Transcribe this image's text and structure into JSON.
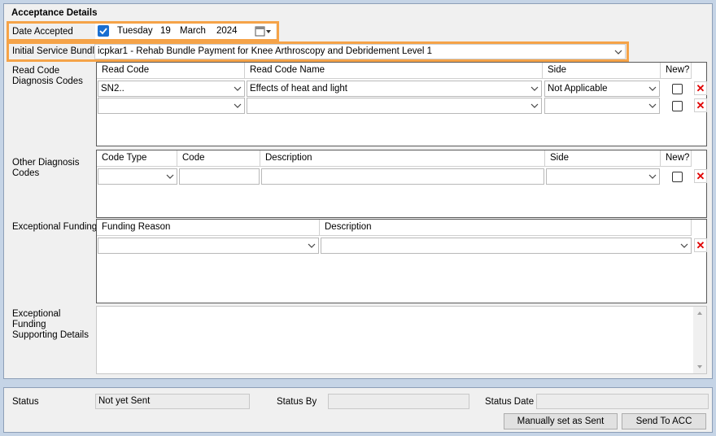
{
  "section_title": "Acceptance Details",
  "date_accepted": {
    "label": "Date Accepted",
    "checked": true,
    "weekday": "Tuesday",
    "day": "19",
    "month": "March",
    "year": "2024"
  },
  "service_bundle": {
    "label": "Initial Service Bundle",
    "value": "icpkar1 - Rehab Bundle Payment for Knee Arthroscopy and Debridement Level 1"
  },
  "read_code": {
    "label": "Read Code Diagnosis Codes",
    "headers": {
      "read_code": "Read Code",
      "read_code_name": "Read Code Name",
      "side": "Side",
      "new": "New?"
    },
    "rows": [
      {
        "read_code": "SN2..",
        "name": "Effects of heat and light",
        "side": "Not Applicable"
      },
      {
        "read_code": "",
        "name": "",
        "side": ""
      }
    ]
  },
  "other_diagnosis": {
    "label": "Other Diagnosis Codes",
    "headers": {
      "code_type": "Code Type",
      "code": "Code",
      "description": "Description",
      "side": "Side",
      "new": "New?"
    },
    "rows": [
      {
        "code_type": "",
        "code": "",
        "description": "",
        "side": ""
      }
    ]
  },
  "exceptional_funding": {
    "label": "Exceptional Funding",
    "headers": {
      "reason": "Funding Reason",
      "description": "Description"
    },
    "rows": [
      {
        "reason": "",
        "description": ""
      }
    ]
  },
  "supporting_details": {
    "label": "Exceptional Funding Supporting Details",
    "value": ""
  },
  "status": {
    "status_label": "Status",
    "status_value": "Not yet Sent",
    "status_by_label": "Status By",
    "status_by_value": "",
    "status_date_label": "Status Date",
    "status_date_value": ""
  },
  "buttons": {
    "manual": "Manually set as Sent",
    "send": "Send To ACC"
  },
  "icons": {
    "delete": "✕",
    "delete_color": "#e00000",
    "highlight_color": "#f5a348"
  }
}
